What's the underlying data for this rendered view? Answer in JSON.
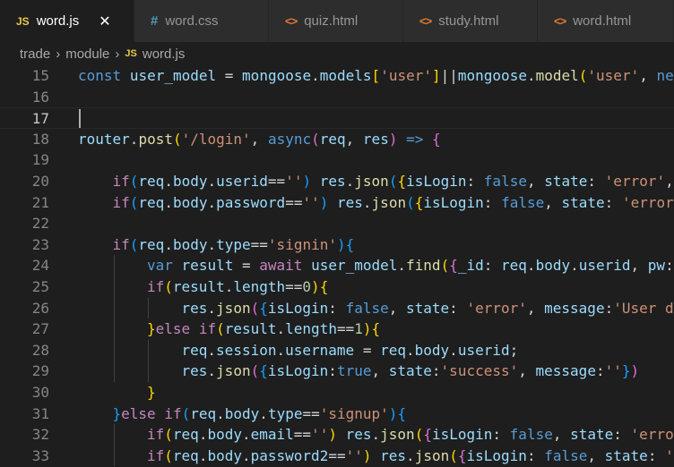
{
  "tabs": [
    {
      "label": "word.js",
      "icon": "js-icon",
      "icon_text": "JS",
      "active": true
    },
    {
      "label": "word.css",
      "icon": "css-icon",
      "icon_text": "#",
      "active": false
    },
    {
      "label": "quiz.html",
      "icon": "html-icon",
      "icon_text": "<>",
      "active": false
    },
    {
      "label": "study.html",
      "icon": "html-icon",
      "icon_text": "<>",
      "active": false
    },
    {
      "label": "word.html",
      "icon": "html-icon",
      "icon_text": "<>",
      "active": false
    }
  ],
  "close_glyph": "✕",
  "breadcrumb": {
    "folder1": "trade",
    "folder2": "module",
    "file_icon_text": "JS",
    "file": "word.js",
    "separator": "›"
  },
  "editor": {
    "current_line": 17,
    "lines": [
      {
        "n": "15",
        "indent": 0,
        "tokens": [
          [
            "kw",
            "const"
          ],
          [
            "pl",
            " "
          ],
          [
            "var",
            "user_model"
          ],
          [
            "pl",
            " = "
          ],
          [
            "var",
            "mongoose"
          ],
          [
            "pl",
            "."
          ],
          [
            "var",
            "models"
          ],
          [
            "b1",
            "["
          ],
          [
            "str",
            "'user'"
          ],
          [
            "b1",
            "]"
          ],
          [
            "pl",
            "||"
          ],
          [
            "var",
            "mongoose"
          ],
          [
            "pl",
            "."
          ],
          [
            "fn",
            "model"
          ],
          [
            "b1",
            "("
          ],
          [
            "str",
            "'user'"
          ],
          [
            "pl",
            ", "
          ],
          [
            "kw",
            "new"
          ]
        ]
      },
      {
        "n": "16",
        "indent": 0,
        "tokens": []
      },
      {
        "n": "17",
        "indent": 0,
        "tokens": []
      },
      {
        "n": "18",
        "indent": 0,
        "tokens": [
          [
            "var",
            "router"
          ],
          [
            "pl",
            "."
          ],
          [
            "fn",
            "post"
          ],
          [
            "b1",
            "("
          ],
          [
            "str",
            "'/login'"
          ],
          [
            "pl",
            ", "
          ],
          [
            "kw",
            "async"
          ],
          [
            "b2",
            "("
          ],
          [
            "var",
            "req"
          ],
          [
            "pl",
            ", "
          ],
          [
            "var",
            "res"
          ],
          [
            "b2",
            ")"
          ],
          [
            "pl",
            " "
          ],
          [
            "kw",
            "=>"
          ],
          [
            "pl",
            " "
          ],
          [
            "b2",
            "{"
          ]
        ]
      },
      {
        "n": "19",
        "indent": 0,
        "tokens": []
      },
      {
        "n": "20",
        "indent": 1,
        "tokens": [
          [
            "ctl",
            "if"
          ],
          [
            "b3",
            "("
          ],
          [
            "var",
            "req"
          ],
          [
            "pl",
            "."
          ],
          [
            "var",
            "body"
          ],
          [
            "pl",
            "."
          ],
          [
            "var",
            "userid"
          ],
          [
            "pl",
            "=="
          ],
          [
            "str",
            "''"
          ],
          [
            "b3",
            ")"
          ],
          [
            "pl",
            " "
          ],
          [
            "var",
            "res"
          ],
          [
            "pl",
            "."
          ],
          [
            "fn",
            "json"
          ],
          [
            "b3",
            "("
          ],
          [
            "b1",
            "{"
          ],
          [
            "var",
            "isLogin"
          ],
          [
            "pl",
            ": "
          ],
          [
            "kw",
            "false"
          ],
          [
            "pl",
            ", "
          ],
          [
            "var",
            "state"
          ],
          [
            "pl",
            ": "
          ],
          [
            "str",
            "'error'"
          ],
          [
            "pl",
            ","
          ]
        ]
      },
      {
        "n": "21",
        "indent": 1,
        "tokens": [
          [
            "ctl",
            "if"
          ],
          [
            "b3",
            "("
          ],
          [
            "var",
            "req"
          ],
          [
            "pl",
            "."
          ],
          [
            "var",
            "body"
          ],
          [
            "pl",
            "."
          ],
          [
            "var",
            "password"
          ],
          [
            "pl",
            "=="
          ],
          [
            "str",
            "''"
          ],
          [
            "b3",
            ")"
          ],
          [
            "pl",
            " "
          ],
          [
            "var",
            "res"
          ],
          [
            "pl",
            "."
          ],
          [
            "fn",
            "json"
          ],
          [
            "b3",
            "("
          ],
          [
            "b1",
            "{"
          ],
          [
            "var",
            "isLogin"
          ],
          [
            "pl",
            ": "
          ],
          [
            "kw",
            "false"
          ],
          [
            "pl",
            ", "
          ],
          [
            "var",
            "state"
          ],
          [
            "pl",
            ": "
          ],
          [
            "str",
            "'error"
          ]
        ]
      },
      {
        "n": "22",
        "indent": 0,
        "tokens": []
      },
      {
        "n": "23",
        "indent": 1,
        "tokens": [
          [
            "ctl",
            "if"
          ],
          [
            "b3",
            "("
          ],
          [
            "var",
            "req"
          ],
          [
            "pl",
            "."
          ],
          [
            "var",
            "body"
          ],
          [
            "pl",
            "."
          ],
          [
            "var",
            "type"
          ],
          [
            "pl",
            "=="
          ],
          [
            "str",
            "'signin'"
          ],
          [
            "b3",
            ")"
          ],
          [
            "b3",
            "{"
          ]
        ]
      },
      {
        "n": "24",
        "indent": 2,
        "tokens": [
          [
            "kw",
            "var"
          ],
          [
            "pl",
            " "
          ],
          [
            "var",
            "result"
          ],
          [
            "pl",
            " = "
          ],
          [
            "ctl",
            "await"
          ],
          [
            "pl",
            " "
          ],
          [
            "var",
            "user_model"
          ],
          [
            "pl",
            "."
          ],
          [
            "fn",
            "find"
          ],
          [
            "b1",
            "("
          ],
          [
            "b2",
            "{"
          ],
          [
            "var",
            "_id"
          ],
          [
            "pl",
            ": "
          ],
          [
            "var",
            "req"
          ],
          [
            "pl",
            "."
          ],
          [
            "var",
            "body"
          ],
          [
            "pl",
            "."
          ],
          [
            "var",
            "userid"
          ],
          [
            "pl",
            ", "
          ],
          [
            "var",
            "pw"
          ],
          [
            "pl",
            ":"
          ]
        ]
      },
      {
        "n": "25",
        "indent": 2,
        "tokens": [
          [
            "ctl",
            "if"
          ],
          [
            "b1",
            "("
          ],
          [
            "var",
            "result"
          ],
          [
            "pl",
            "."
          ],
          [
            "var",
            "length"
          ],
          [
            "pl",
            "=="
          ],
          [
            "num",
            "0"
          ],
          [
            "b1",
            ")"
          ],
          [
            "b1",
            "{"
          ]
        ]
      },
      {
        "n": "26",
        "indent": 3,
        "tokens": [
          [
            "var",
            "res"
          ],
          [
            "pl",
            "."
          ],
          [
            "fn",
            "json"
          ],
          [
            "b2",
            "("
          ],
          [
            "b3",
            "{"
          ],
          [
            "var",
            "isLogin"
          ],
          [
            "pl",
            ": "
          ],
          [
            "kw",
            "false"
          ],
          [
            "pl",
            ", "
          ],
          [
            "var",
            "state"
          ],
          [
            "pl",
            ": "
          ],
          [
            "str",
            "'error'"
          ],
          [
            "pl",
            ", "
          ],
          [
            "var",
            "message"
          ],
          [
            "pl",
            ":"
          ],
          [
            "str",
            "'User do"
          ]
        ]
      },
      {
        "n": "27",
        "indent": 2,
        "tokens": [
          [
            "b1",
            "}"
          ],
          [
            "ctl",
            "else"
          ],
          [
            "pl",
            " "
          ],
          [
            "ctl",
            "if"
          ],
          [
            "b1",
            "("
          ],
          [
            "var",
            "result"
          ],
          [
            "pl",
            "."
          ],
          [
            "var",
            "length"
          ],
          [
            "pl",
            "=="
          ],
          [
            "num",
            "1"
          ],
          [
            "b1",
            ")"
          ],
          [
            "b1",
            "{"
          ]
        ]
      },
      {
        "n": "28",
        "indent": 3,
        "tokens": [
          [
            "var",
            "req"
          ],
          [
            "pl",
            "."
          ],
          [
            "var",
            "session"
          ],
          [
            "pl",
            "."
          ],
          [
            "var",
            "username"
          ],
          [
            "pl",
            " = "
          ],
          [
            "var",
            "req"
          ],
          [
            "pl",
            "."
          ],
          [
            "var",
            "body"
          ],
          [
            "pl",
            "."
          ],
          [
            "var",
            "userid"
          ],
          [
            "pl",
            ";"
          ]
        ]
      },
      {
        "n": "29",
        "indent": 3,
        "tokens": [
          [
            "var",
            "res"
          ],
          [
            "pl",
            "."
          ],
          [
            "fn",
            "json"
          ],
          [
            "b2",
            "("
          ],
          [
            "b3",
            "{"
          ],
          [
            "var",
            "isLogin"
          ],
          [
            "pl",
            ":"
          ],
          [
            "kw",
            "true"
          ],
          [
            "pl",
            ", "
          ],
          [
            "var",
            "state"
          ],
          [
            "pl",
            ":"
          ],
          [
            "str",
            "'success'"
          ],
          [
            "pl",
            ", "
          ],
          [
            "var",
            "message"
          ],
          [
            "pl",
            ":"
          ],
          [
            "str",
            "''"
          ],
          [
            "b3",
            "}"
          ],
          [
            "b2",
            ")"
          ]
        ]
      },
      {
        "n": "30",
        "indent": 2,
        "tokens": [
          [
            "b1",
            "}"
          ]
        ]
      },
      {
        "n": "31",
        "indent": 1,
        "tokens": [
          [
            "b3",
            "}"
          ],
          [
            "ctl",
            "else"
          ],
          [
            "pl",
            " "
          ],
          [
            "ctl",
            "if"
          ],
          [
            "b3",
            "("
          ],
          [
            "var",
            "req"
          ],
          [
            "pl",
            "."
          ],
          [
            "var",
            "body"
          ],
          [
            "pl",
            "."
          ],
          [
            "var",
            "type"
          ],
          [
            "pl",
            "=="
          ],
          [
            "str",
            "'signup'"
          ],
          [
            "b3",
            ")"
          ],
          [
            "b3",
            "{"
          ]
        ]
      },
      {
        "n": "32",
        "indent": 2,
        "tokens": [
          [
            "ctl",
            "if"
          ],
          [
            "b1",
            "("
          ],
          [
            "var",
            "req"
          ],
          [
            "pl",
            "."
          ],
          [
            "var",
            "body"
          ],
          [
            "pl",
            "."
          ],
          [
            "var",
            "email"
          ],
          [
            "pl",
            "=="
          ],
          [
            "str",
            "''"
          ],
          [
            "b1",
            ")"
          ],
          [
            "pl",
            " "
          ],
          [
            "var",
            "res"
          ],
          [
            "pl",
            "."
          ],
          [
            "fn",
            "json"
          ],
          [
            "b1",
            "("
          ],
          [
            "b2",
            "{"
          ],
          [
            "var",
            "isLogin"
          ],
          [
            "pl",
            ": "
          ],
          [
            "kw",
            "false"
          ],
          [
            "pl",
            ", "
          ],
          [
            "var",
            "state"
          ],
          [
            "pl",
            ": "
          ],
          [
            "str",
            "'erro"
          ]
        ]
      },
      {
        "n": "33",
        "indent": 2,
        "tokens": [
          [
            "ctl",
            "if"
          ],
          [
            "b1",
            "("
          ],
          [
            "var",
            "req"
          ],
          [
            "pl",
            "."
          ],
          [
            "var",
            "body"
          ],
          [
            "pl",
            "."
          ],
          [
            "var",
            "password2"
          ],
          [
            "pl",
            "=="
          ],
          [
            "str",
            "''"
          ],
          [
            "b1",
            ")"
          ],
          [
            "pl",
            " "
          ],
          [
            "var",
            "res"
          ],
          [
            "pl",
            "."
          ],
          [
            "fn",
            "json"
          ],
          [
            "b1",
            "("
          ],
          [
            "b2",
            "{"
          ],
          [
            "var",
            "isLogin"
          ],
          [
            "pl",
            ": "
          ],
          [
            "kw",
            "false"
          ],
          [
            "pl",
            ", "
          ],
          [
            "var",
            "state"
          ],
          [
            "pl",
            ": "
          ],
          [
            "str",
            "'e"
          ]
        ]
      }
    ]
  }
}
